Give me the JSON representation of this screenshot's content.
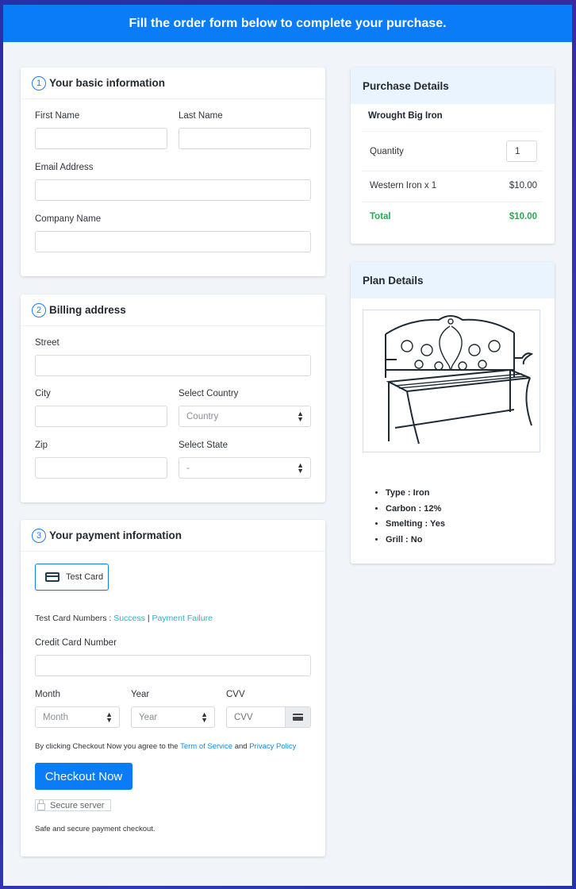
{
  "banner": {
    "text": "Fill the order form below to complete your purchase."
  },
  "basic_info": {
    "step": "1",
    "title": "Your basic information",
    "first_name_label": "First Name",
    "first_name_value": "",
    "last_name_label": "Last Name",
    "last_name_value": "",
    "email_label": "Email Address",
    "email_value": "",
    "company_label": "Company Name",
    "company_value": ""
  },
  "billing": {
    "step": "2",
    "title": "Billing address",
    "street_label": "Street",
    "street_value": "",
    "city_label": "City",
    "city_value": "",
    "country_label": "Select Country",
    "country_selected": "Country",
    "zip_label": "Zip",
    "zip_value": "",
    "state_label": "Select State",
    "state_selected": "-"
  },
  "payment": {
    "step": "3",
    "title": "Your payment information",
    "card_option_label": "Test Card",
    "card_option_icon": "credit-card-icon",
    "test_numbers_label": "Test Card Numbers :",
    "success_link": "Success",
    "separator": "|",
    "failure_link": "Payment Failure",
    "cc_label": "Credit Card Number",
    "cc_value": "",
    "month_label": "Month",
    "month_selected": "Month",
    "year_label": "Year",
    "year_selected": "Year",
    "cvv_label": "CVV",
    "cvv_placeholder": "CVV",
    "agree_prefix": "By clicking Checkout Now you agree to the",
    "tos_link": "Term of Service",
    "agree_and": "and",
    "privacy_link": "Privacy Policy",
    "checkout_button": "Checkout Now",
    "secure_badge": "Secure server",
    "secure_note": "Safe and secure payment checkout."
  },
  "purchase": {
    "title": "Purchase Details",
    "product_name": "Wrought Big Iron",
    "quantity_label": "Quantity",
    "quantity_value": "1",
    "line_item_label": "Western Iron x 1",
    "line_item_price": "$10.00",
    "total_label": "Total",
    "total_value": "$10.00",
    "total_color": "#2ea84f"
  },
  "plan": {
    "title": "Plan Details",
    "image_alt": "wrought iron garden bench",
    "features": [
      "Type : Iron",
      "Carbon : 12%",
      "Smelting : Yes",
      "Grill : No"
    ]
  },
  "colors": {
    "accent": "#0a7cf8",
    "link": "#1a86e6",
    "teal_link": "#22b4c9"
  }
}
